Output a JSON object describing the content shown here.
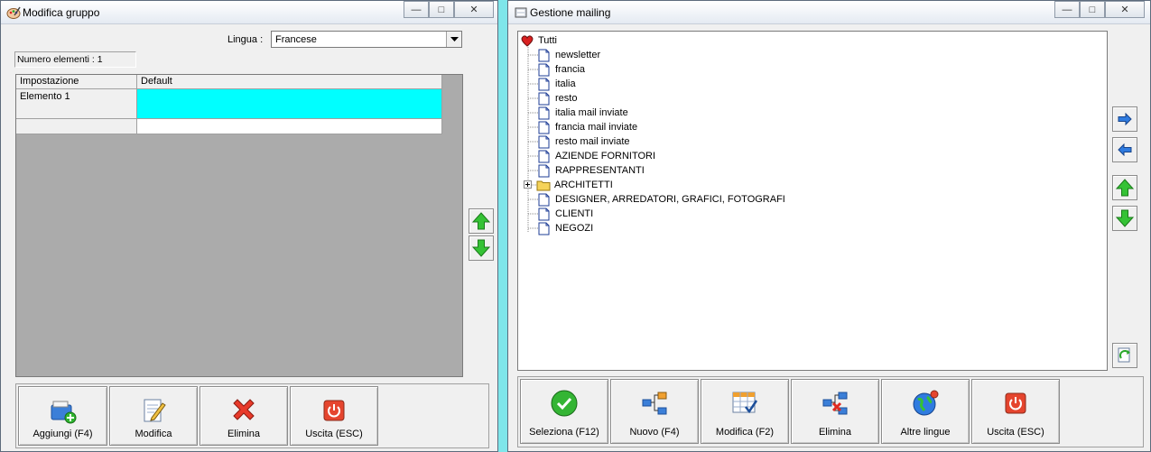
{
  "left_window": {
    "title": "Modifica gruppo",
    "lingua_label": "Lingua :",
    "lingua_value": "Francese",
    "count_label": "Numero elementi : 1",
    "grid": {
      "headers": [
        "Impostazione",
        "Default"
      ],
      "rows": [
        [
          "Elemento 1",
          ""
        ]
      ]
    },
    "buttons": {
      "add": "Aggiungi (F4)",
      "edit": "Modifica",
      "delete": "Elimina",
      "exit": "Uscita (ESC)"
    }
  },
  "right_window": {
    "title": "Gestione mailing",
    "tree": {
      "root": "Tutti",
      "items": [
        "newsletter",
        "francia",
        "italia",
        "resto",
        "italia mail inviate",
        "francia mail inviate",
        "resto mail inviate",
        "AZIENDE FORNITORI",
        "RAPPRESENTANTI",
        "ARCHITETTI",
        "DESIGNER, ARREDATORI, GRAFICI, FOTOGRAFI",
        "CLIENTI",
        "NEGOZI"
      ]
    },
    "buttons": {
      "select": "Seleziona (F12)",
      "new": "Nuovo (F4)",
      "edit": "Modifica (F2)",
      "delete": "Elimina",
      "languages": "Altre lingue",
      "exit": "Uscita (ESC)"
    }
  },
  "colors": {
    "selected_cell": "#00ffff",
    "grid_background": "#ababab",
    "desktop": "#7fe6ea"
  }
}
